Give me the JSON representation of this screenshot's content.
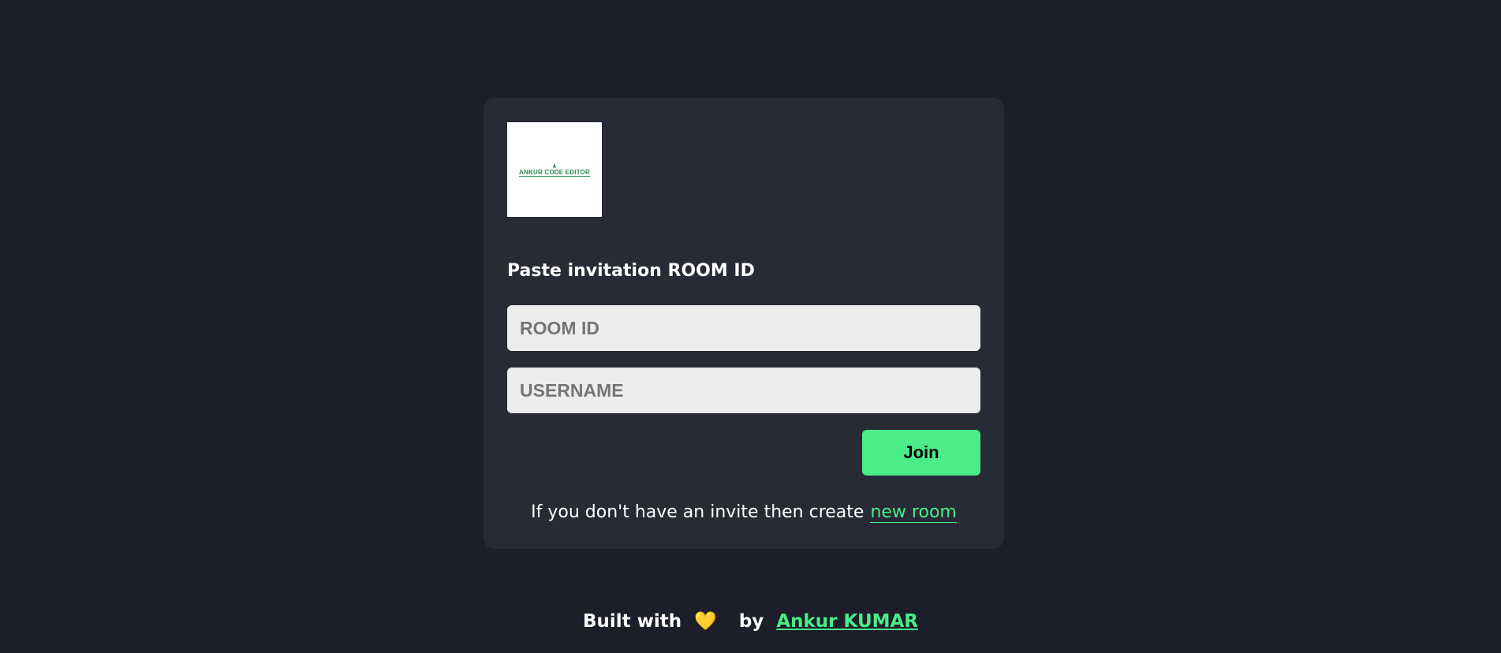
{
  "logo": {
    "text": "ANKUR CODE EDITOR"
  },
  "form": {
    "title": "Paste invitation ROOM ID",
    "room_id_placeholder": "ROOM ID",
    "username_placeholder": "USERNAME",
    "join_label": "Join",
    "invite_text": "If you don't have an invite then create",
    "new_room_link": "new room"
  },
  "footer": {
    "built_with": "Built with",
    "heart": "💛",
    "by": "by",
    "author": "Ankur KUMAR"
  },
  "colors": {
    "background": "#1c1e29",
    "card": "#282a36",
    "accent": "#4aed88",
    "input_bg": "#ededed"
  }
}
